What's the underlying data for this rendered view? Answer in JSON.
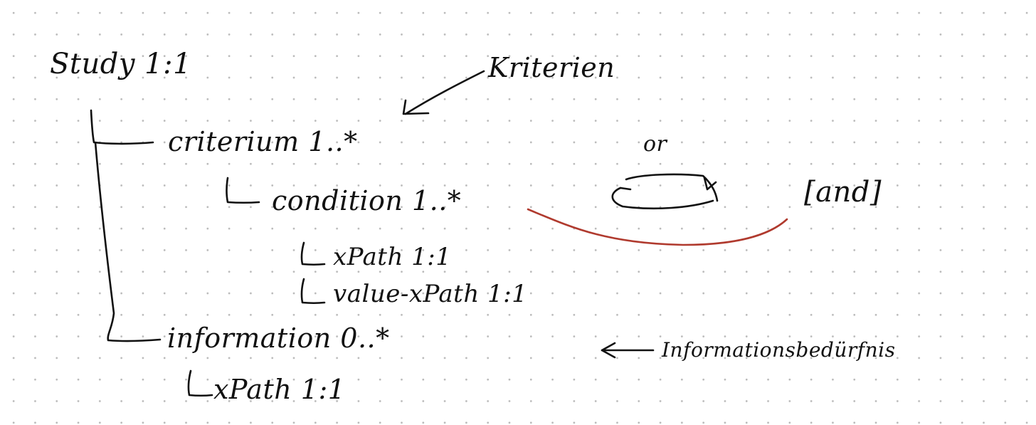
{
  "diagram": {
    "nodes": {
      "study": "Study 1:1",
      "criterium": "criterium 1..*",
      "condition": "condition 1..*",
      "xpath_condition": "xPath 1:1",
      "value_xpath": "value-xPath 1:1",
      "information": "information 0..*",
      "xpath_information": "xPath 1:1"
    },
    "annotations": {
      "kriterien": "Kriterien",
      "or": "or",
      "and": "[and]",
      "informationsbeduerfnis": "Informationsbedürfnis"
    },
    "colors": {
      "ink": "#111111",
      "red_ink": "#b03a2e",
      "grid_dots": "#b9b9b9",
      "paper": "#ffffff"
    }
  }
}
